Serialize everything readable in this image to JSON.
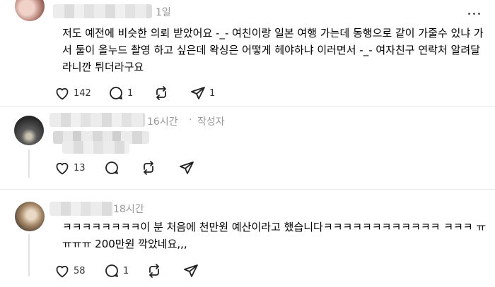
{
  "posts": [
    {
      "time": "1일",
      "text": "저도 예전에 비슷한 의뢰 받았어요 -_- 여친이랑 일본 여행 가는데 동행으로 같이 가줄수 있냐 가서 둘이 올누드 촬영 하고 싶은데 왁싱은 어떻게 헤야하냐 이러면서 -_- 여자친구 연락처 알려달라니깐 튀더라구요",
      "likes": "142",
      "replies": "1",
      "reposts": "",
      "shares": "1"
    },
    {
      "time": "16시간",
      "separator": "·",
      "author_tag": "작성자",
      "likes": "13",
      "replies": "",
      "reposts": "",
      "shares": ""
    },
    {
      "time": "18시간",
      "text": "ㅋㅋㅋㅋㅋㅋㅋㅋ이 분 처음에 천만원 예산이라고 했습니다ㅋㅋㅋㅋㅋㅋㅋㅋㅋㅋㅋㅋ ㅋㅋㅋ ㅠㅠㅠㅠ 200만원 깍았네요,,,",
      "likes": "58",
      "replies": "1",
      "reposts": "",
      "shares": ""
    }
  ],
  "icons": [
    "heart-icon",
    "comment-icon",
    "repost-icon",
    "share-icon",
    "more-icon"
  ]
}
